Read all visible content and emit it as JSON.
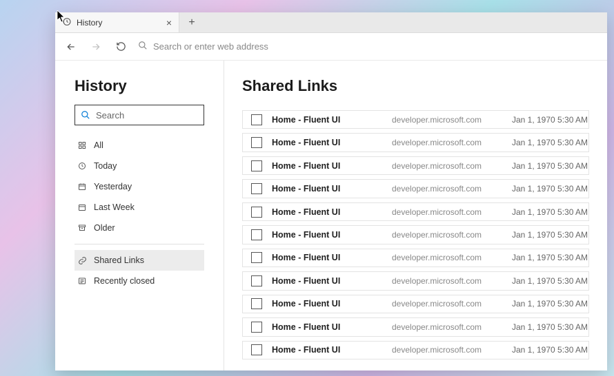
{
  "tab": {
    "title": "History"
  },
  "omnibox": {
    "placeholder": "Search or enter web address"
  },
  "sidebar": {
    "heading": "History",
    "search_placeholder": "Search",
    "group1": [
      {
        "icon": "grid",
        "label": "All"
      },
      {
        "icon": "clock",
        "label": "Today"
      },
      {
        "icon": "calendar-week",
        "label": "Yesterday"
      },
      {
        "icon": "calendar",
        "label": "Last Week"
      },
      {
        "icon": "archive",
        "label": "Older"
      }
    ],
    "group2": [
      {
        "icon": "link",
        "label": "Shared Links",
        "selected": true
      },
      {
        "icon": "history",
        "label": "Recently closed"
      }
    ]
  },
  "main": {
    "heading": "Shared Links",
    "rows": [
      {
        "title": "Home - Fluent UI",
        "url": "developer.microsoft.com",
        "time": "Jan 1, 1970 5:30 AM"
      },
      {
        "title": "Home - Fluent UI",
        "url": "developer.microsoft.com",
        "time": "Jan 1, 1970 5:30 AM"
      },
      {
        "title": "Home - Fluent UI",
        "url": "developer.microsoft.com",
        "time": "Jan 1, 1970 5:30 AM"
      },
      {
        "title": "Home - Fluent UI",
        "url": "developer.microsoft.com",
        "time": "Jan 1, 1970 5:30 AM"
      },
      {
        "title": "Home - Fluent UI",
        "url": "developer.microsoft.com",
        "time": "Jan 1, 1970 5:30 AM"
      },
      {
        "title": "Home - Fluent UI",
        "url": "developer.microsoft.com",
        "time": "Jan 1, 1970 5:30 AM"
      },
      {
        "title": "Home - Fluent UI",
        "url": "developer.microsoft.com",
        "time": "Jan 1, 1970 5:30 AM"
      },
      {
        "title": "Home - Fluent UI",
        "url": "developer.microsoft.com",
        "time": "Jan 1, 1970 5:30 AM"
      },
      {
        "title": "Home - Fluent UI",
        "url": "developer.microsoft.com",
        "time": "Jan 1, 1970 5:30 AM"
      },
      {
        "title": "Home - Fluent UI",
        "url": "developer.microsoft.com",
        "time": "Jan 1, 1970 5:30 AM"
      },
      {
        "title": "Home - Fluent UI",
        "url": "developer.microsoft.com",
        "time": "Jan 1, 1970 5:30 AM"
      }
    ]
  }
}
